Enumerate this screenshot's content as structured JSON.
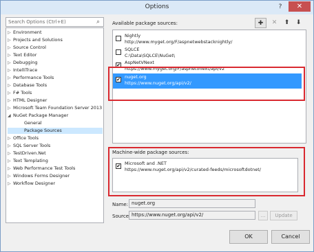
{
  "window": {
    "title": "Options",
    "help": "?",
    "close": "✕"
  },
  "search": {
    "placeholder": "Search Options (Ctrl+E)",
    "icon": "⌕"
  },
  "tree": {
    "items": [
      {
        "label": "Environment",
        "arrow": "▷"
      },
      {
        "label": "Projects and Solutions",
        "arrow": "▷"
      },
      {
        "label": "Source Control",
        "arrow": "▷"
      },
      {
        "label": "Text Editor",
        "arrow": "▷"
      },
      {
        "label": "Debugging",
        "arrow": "▷"
      },
      {
        "label": "IntelliTrace",
        "arrow": "▷"
      },
      {
        "label": "Performance Tools",
        "arrow": "▷"
      },
      {
        "label": "Database Tools",
        "arrow": "▷"
      },
      {
        "label": "F# Tools",
        "arrow": "▷"
      },
      {
        "label": "HTML Designer",
        "arrow": "▷"
      },
      {
        "label": "Microsoft Team Foundation Server 2013",
        "arrow": "▷"
      },
      {
        "label": "NuGet Package Manager",
        "arrow": "◢"
      },
      {
        "label": "General",
        "arrow": ""
      },
      {
        "label": "Package Sources",
        "arrow": ""
      },
      {
        "label": "Office Tools",
        "arrow": "▷"
      },
      {
        "label": "SQL Server Tools",
        "arrow": "▷"
      },
      {
        "label": "TestDriven.Net",
        "arrow": "▷"
      },
      {
        "label": "Text Templating",
        "arrow": "▷"
      },
      {
        "label": "Web Performance Test Tools",
        "arrow": "▷"
      },
      {
        "label": "Windows Forms Designer",
        "arrow": "▷"
      },
      {
        "label": "Workflow Designer",
        "arrow": "▷"
      }
    ]
  },
  "available": {
    "label": "Available package sources:",
    "buttons": {
      "add": "✚",
      "remove": "✕",
      "up": "⬆",
      "down": "⬇"
    },
    "sources": [
      {
        "name": "Nightly",
        "url": "http://www.myget.org/F/aspnetwebstacknightly/",
        "check": ""
      },
      {
        "name": "SQLCE",
        "url": "C:\\Data\\SQLCE\\NuGet\\",
        "check": ""
      },
      {
        "name": "AspNetVNext",
        "url": "https://www.myget.org/F/aspnetvnext/api/v2",
        "check": "✔"
      },
      {
        "name": "nuget.org",
        "url": "https://www.nuget.org/api/v2/",
        "check": "✔"
      }
    ]
  },
  "machine": {
    "label": "Machine-wide package sources:",
    "sources": [
      {
        "name": "Microsoft and .NET",
        "url": "https://www.nuget.org/api/v2/curated-feeds/microsoftdotnet/",
        "check": "✔"
      }
    ]
  },
  "form": {
    "name_label": "Name:",
    "name_value": "nuget.org",
    "source_label": "Source:",
    "source_value": "https://www.nuget.org/api/v2/",
    "browse": "...",
    "update": "Update"
  },
  "footer": {
    "ok": "OK",
    "cancel": "Cancel"
  },
  "colors": {
    "highlight": "#d9282f",
    "selection": "#3399ff",
    "tree_selection": "#cce8ff"
  }
}
